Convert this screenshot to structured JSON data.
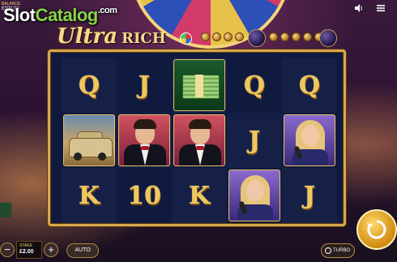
{
  "watermark": {
    "slot": "Slot",
    "catalog": "Catalog",
    "com": ".com"
  },
  "balance": {
    "label": "BALANCE",
    "value": "£300.00"
  },
  "logo": {
    "ultra": "Ultra",
    "rich": "RICH"
  },
  "top_icons": {
    "sound": "speaker-icon",
    "menu": "menu-icon"
  },
  "reels": [
    [
      {
        "kind": "letter",
        "text": "Q"
      },
      {
        "kind": "letter",
        "text": "J"
      },
      {
        "kind": "cash",
        "icon": "cash-stack-icon"
      },
      {
        "kind": "letter",
        "text": "Q"
      },
      {
        "kind": "letter",
        "text": "Q"
      }
    ],
    [
      {
        "kind": "car",
        "icon": "car-icon"
      },
      {
        "kind": "man",
        "icon": "gentleman-icon"
      },
      {
        "kind": "man",
        "icon": "gentleman-icon"
      },
      {
        "kind": "letter",
        "text": "J"
      },
      {
        "kind": "woman",
        "icon": "singer-icon"
      }
    ],
    [
      {
        "kind": "letter",
        "text": "K"
      },
      {
        "kind": "letter",
        "text": "10"
      },
      {
        "kind": "letter",
        "text": "K"
      },
      {
        "kind": "woman",
        "icon": "singer-icon"
      },
      {
        "kind": "letter",
        "text": "J"
      }
    ]
  ],
  "controls": {
    "stake_label": "STAKE",
    "stake_value": "£2.00",
    "minus": "−",
    "plus": "+",
    "auto": "AUTO",
    "turbo": "TURBO",
    "spin": "spin-icon"
  }
}
